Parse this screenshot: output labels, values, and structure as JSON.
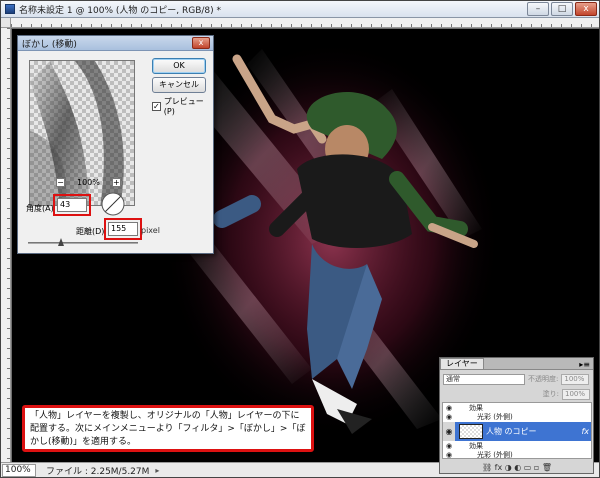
{
  "window": {
    "title": "名称未設定 1 @ 100% (人物 のコピー, RGB/8) *",
    "buttons": {
      "minimize": "–",
      "maximize": "□",
      "close": "x"
    }
  },
  "status": {
    "zoom": "100%",
    "file_info": "ファイル : 2.25M/5.27M",
    "arrow": "▸"
  },
  "dialog": {
    "title": "ぼかし (移動)",
    "close": "x",
    "ok_label": "OK",
    "cancel_label": "キャンセル",
    "preview_label": "プレビュー(P)",
    "preview_checked": "✓",
    "zoom_minus": "−",
    "zoom_plus": "+",
    "zoom_percent": "100%",
    "angle_label": "角度(A)",
    "angle_value": "43",
    "distance_label": "距離(D)",
    "distance_value": "155",
    "distance_unit": "pixel",
    "slider_position": 0.3
  },
  "layers_panel": {
    "tab_label": "レイヤー",
    "menu_icon": "▸≡",
    "blend_mode": "通常",
    "opacity_label": "不透明度:",
    "opacity_value": "100%",
    "fill_label": "塗り:",
    "fill_value": "100%",
    "rows": {
      "effects_1": "効果",
      "outer_glow_1": "光彩 (外側)",
      "selected_layer": "人物 のコピー",
      "fx": "fx",
      "effects_2": "効果",
      "outer_glow_2": "光彩 (外側)"
    },
    "footer_icons": "⛓ fx ◑ ◐ ▭ ▫ 🗑"
  },
  "annotation": {
    "text": "「人物」レイヤーを複製し、オリジナルの「人物」レイヤーの下に配置する。次にメインメニューより「フィルタ」>「ぼかし」>「ぼかし(移動)」を適用する。"
  },
  "colors": {
    "highlight_red": "#dd1111",
    "selection_blue": "#3e74d2",
    "glow_pink": "#e0407a"
  }
}
